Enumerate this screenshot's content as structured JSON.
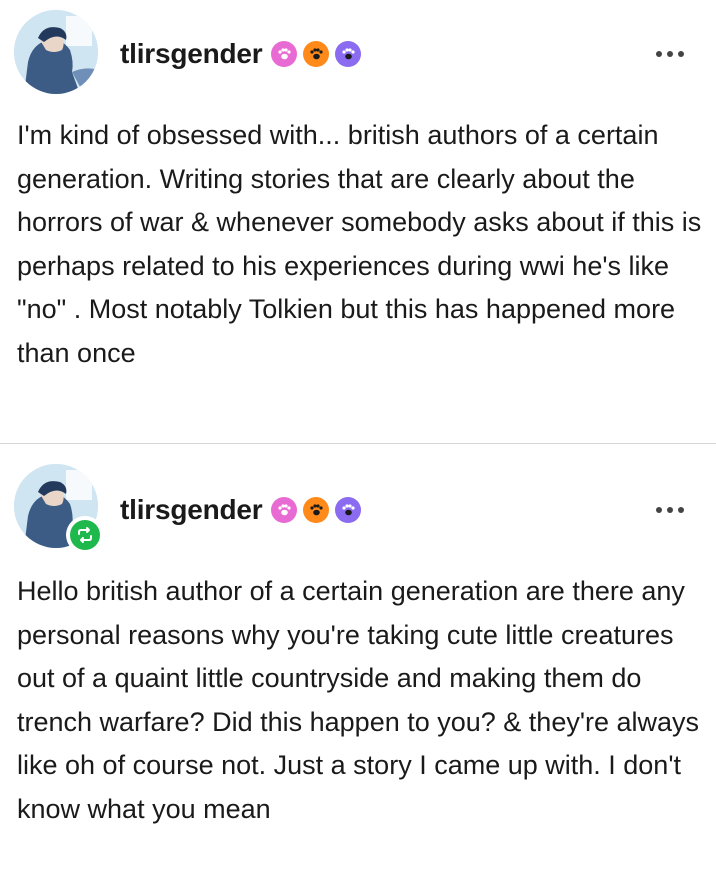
{
  "posts": [
    {
      "username": "tlirsgender",
      "badges": [
        "pink-paw-badge",
        "orange-paw-badge",
        "purple-paw-badge"
      ],
      "reblogged": false,
      "text": "I'm kind of obsessed with... british authors of a certain generation. Writing stories that are clearly about the horrors of war & whenever somebody asks about if this is perhaps related to his experiences during wwi he's like \"no\" . Most notably Tolkien but this has happened more than once"
    },
    {
      "username": "tlirsgender",
      "badges": [
        "pink-paw-badge",
        "orange-paw-badge",
        "purple-paw-badge"
      ],
      "reblogged": true,
      "text": "Hello british author of a certain generation are there any personal reasons why you're taking cute little creatures out of a quaint little countryside and making them do trench warfare? Did this happen to you? & they're always like oh of course not. Just a story I came up with. I don't know what you mean"
    }
  ],
  "colors": {
    "badge_pink": "#e86bd4",
    "badge_orange": "#ff8a1a",
    "badge_purple": "#8b6bf0",
    "reblog_green": "#1fb84d",
    "divider": "#d6d6d6"
  }
}
